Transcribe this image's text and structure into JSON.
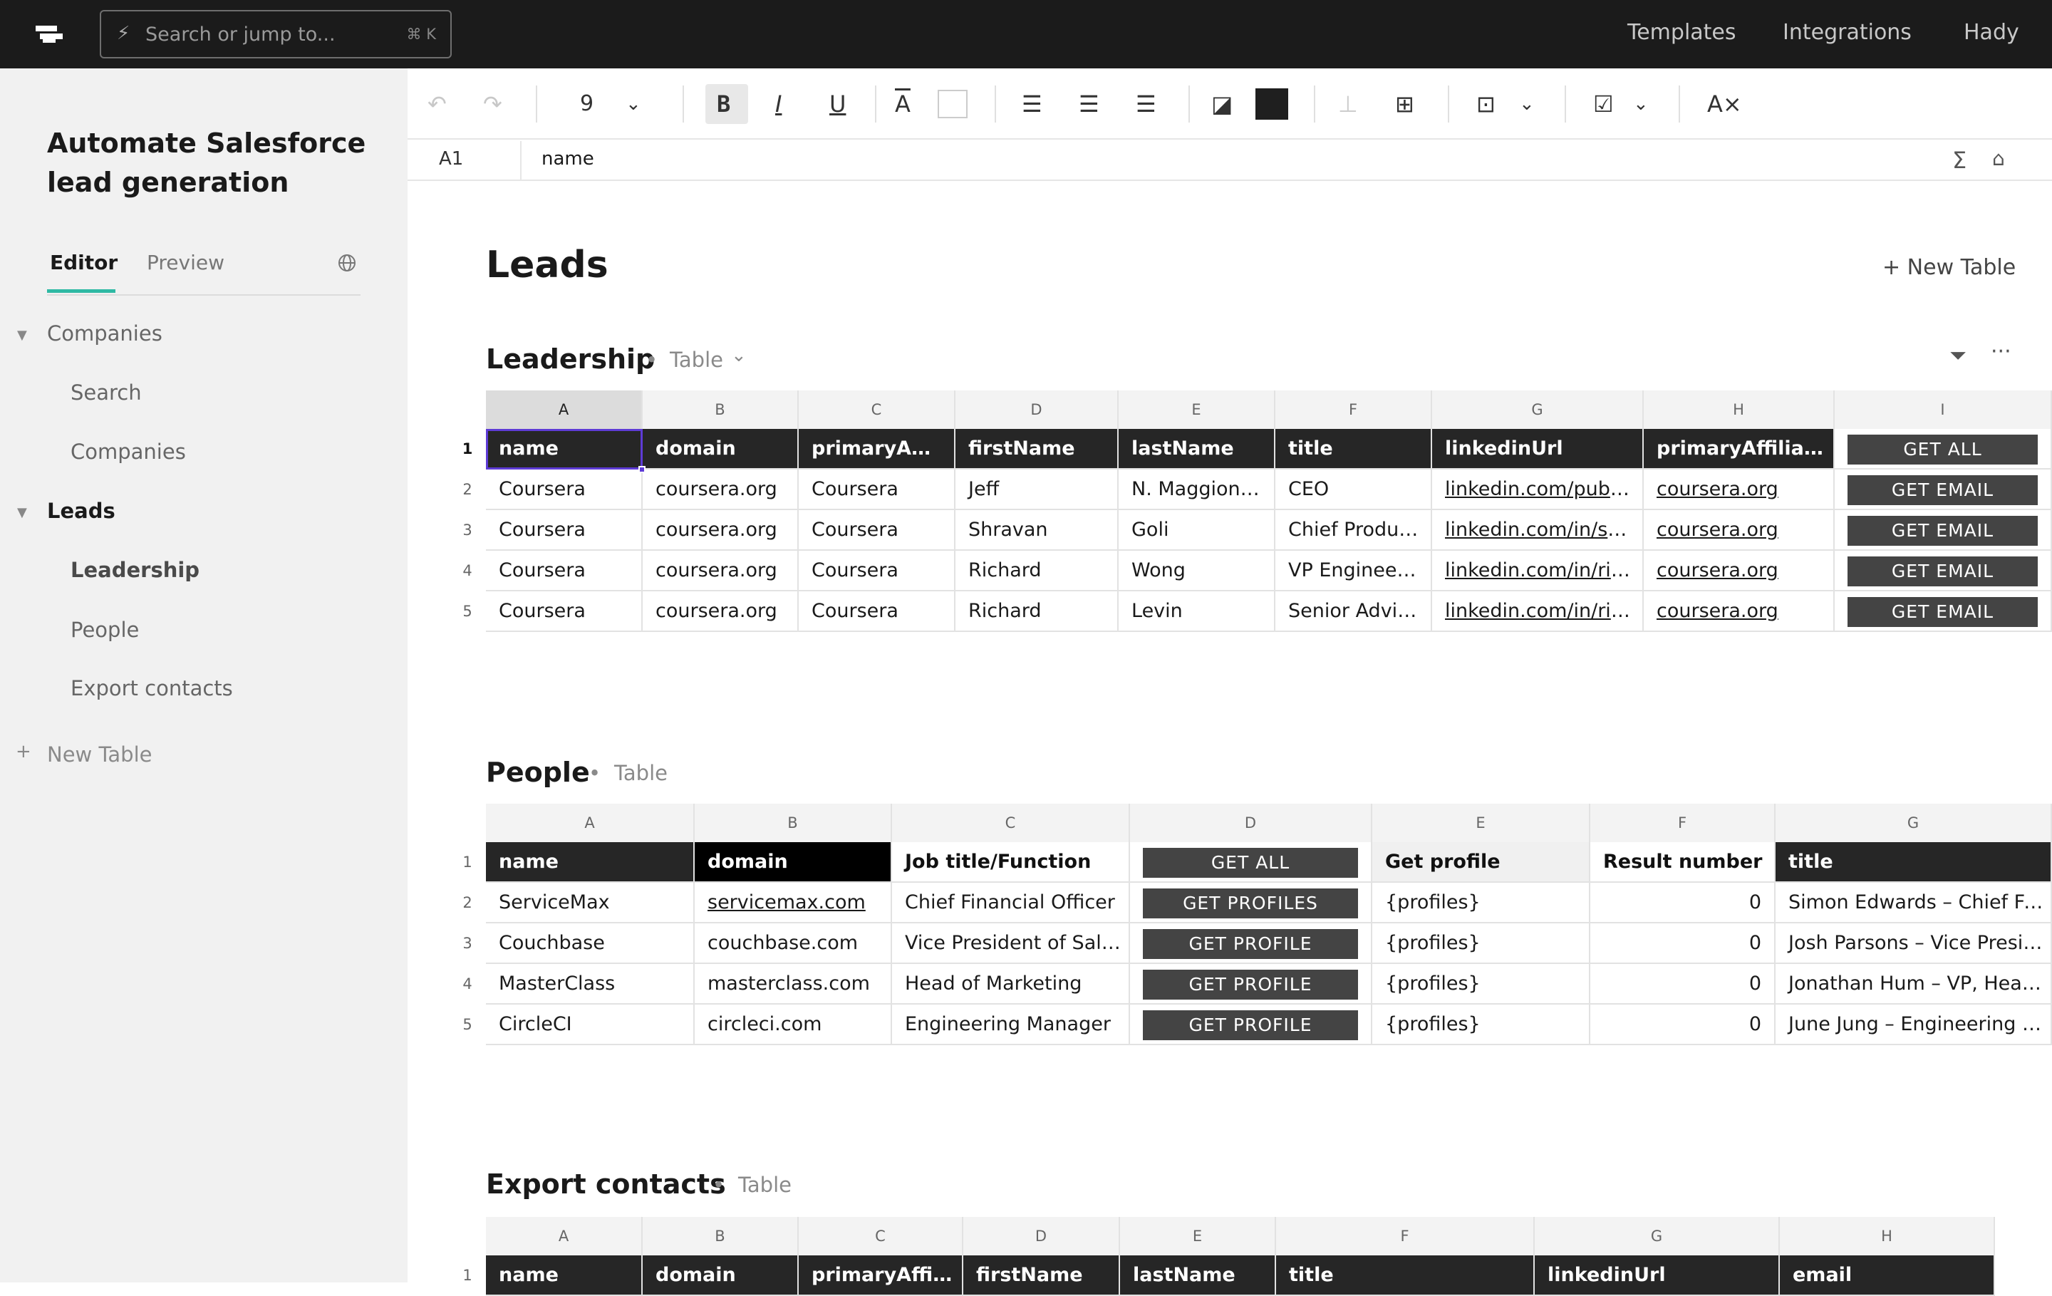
{
  "topbar": {
    "search_placeholder": "Search or jump to...",
    "search_shortcut": "⌘ K",
    "nav": [
      "Templates",
      "Integrations",
      "Hady"
    ]
  },
  "sidebar": {
    "title_line1": "Automate Salesforce",
    "title_line2": "lead generation",
    "tabs": [
      "Editor",
      "Preview"
    ],
    "groups": [
      {
        "label": "Companies",
        "items": [
          "Search",
          "Companies"
        ]
      },
      {
        "label": "Leads",
        "items": [
          "Leadership",
          "People",
          "Export contacts"
        ]
      }
    ],
    "new_table": "New Table"
  },
  "toolbar": {
    "font_size": "9"
  },
  "formula_bar": {
    "cell_ref": "A1",
    "value": "name"
  },
  "page": {
    "title": "Leads",
    "new_table": "+ New Table"
  },
  "sections": {
    "leadership": {
      "title": "Leadership",
      "type_label": "Table",
      "col_letters": [
        "A",
        "B",
        "C",
        "D",
        "E",
        "F",
        "G",
        "H",
        "I"
      ],
      "headers": [
        "name",
        "domain",
        "primaryAffil...",
        "firstName",
        "lastName",
        "title",
        "linkedinUrl",
        "primaryAffiliati...",
        "GET ALL"
      ],
      "rows": [
        [
          "Coursera",
          "coursera.org",
          "Coursera",
          "Jeff",
          "N. Maggionc...",
          "CEO",
          "linkedin.com/pub/j...",
          "coursera.org",
          "GET EMAIL"
        ],
        [
          "Coursera",
          "coursera.org",
          "Coursera",
          "Shravan",
          "Goli",
          "Chief Produc...",
          "linkedin.com/in/sh...",
          "coursera.org",
          "GET EMAIL"
        ],
        [
          "Coursera",
          "coursera.org",
          "Coursera",
          "Richard",
          "Wong",
          "VP Engineering",
          "linkedin.com/in/ric...",
          "coursera.org",
          "GET EMAIL"
        ],
        [
          "Coursera",
          "coursera.org",
          "Coursera",
          "Richard",
          "Levin",
          "Senior Advisor",
          "linkedin.com/in/ric...",
          "coursera.org",
          "GET EMAIL"
        ]
      ]
    },
    "people": {
      "title": "People",
      "type_label": "Table",
      "col_letters": [
        "A",
        "B",
        "C",
        "D",
        "E",
        "F",
        "G"
      ],
      "headers": [
        "name",
        "domain",
        "Job title/Function",
        "GET ALL",
        "Get profile",
        "Result number",
        "title"
      ],
      "rows": [
        [
          "ServiceMax",
          "servicemax.com",
          "Chief Financial Officer",
          "GET PROFILES",
          "{profiles}",
          "0",
          "Simon Edwards – Chief Financ"
        ],
        [
          "Couchbase",
          "couchbase.com",
          "Vice President of Sales",
          "GET PROFILE",
          "{profiles}",
          "0",
          "Josh Parsons – Vice President"
        ],
        [
          "MasterClass",
          "masterclass.com",
          "Head of Marketing",
          "GET PROFILE",
          "{profiles}",
          "0",
          "Jonathan Hum – VP, Head of M"
        ],
        [
          "CircleCI",
          "circleci.com",
          "Engineering Manager",
          "GET PROFILE",
          "{profiles}",
          "0",
          "June Jung – Engineering Mana"
        ]
      ]
    },
    "export": {
      "title": "Export contacts",
      "type_label": "Table",
      "col_letters": [
        "A",
        "B",
        "C",
        "D",
        "E",
        "F",
        "G",
        "H"
      ],
      "headers": [
        "name",
        "domain",
        "primaryAffili...",
        "firstName",
        "lastName",
        "title",
        "linkedinUrl",
        "email"
      ]
    }
  }
}
